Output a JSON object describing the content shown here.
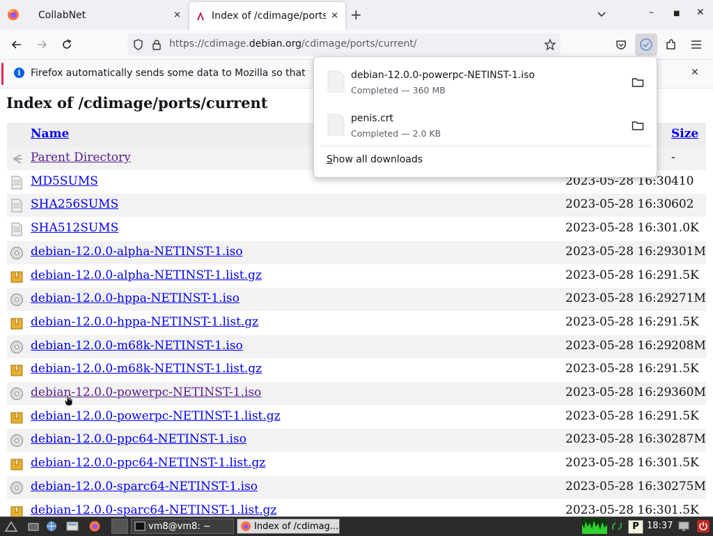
{
  "browser": {
    "tabs": [
      {
        "label": "CollabNet"
      },
      {
        "label": "Index of /cdimage/ports/current/"
      }
    ],
    "url": {
      "prefix": "https://cdimage.",
      "domain": "debian.org",
      "path": "/cdimage/ports/current/"
    },
    "notification": "Firefox automatically sends some data to Mozilla so that we can improve your experience."
  },
  "downloads": {
    "items": [
      {
        "name": "debian-12.0.0-powerpc-NETINST-1.iso",
        "status": "Completed — 360 MB"
      },
      {
        "name": "penis.crt",
        "status": "Completed — 2.0 KB"
      }
    ],
    "show_all_accel": "S",
    "show_all_rest": "how all downloads"
  },
  "page": {
    "heading": "Index of /cdimage/ports/current",
    "columns": {
      "name": "Name",
      "size": "Size"
    },
    "rows": [
      {
        "name": "Parent Directory",
        "date": "",
        "size": "-",
        "icon": "parent-dir-icon",
        "visited": true
      },
      {
        "name": "MD5SUMS",
        "date": "2023-05-28 16:30",
        "size": "410",
        "icon": "text-file-icon",
        "visited": false
      },
      {
        "name": "SHA256SUMS",
        "date": "2023-05-28 16:30",
        "size": "602",
        "icon": "text-file-icon",
        "visited": false
      },
      {
        "name": "SHA512SUMS",
        "date": "2023-05-28 16:30",
        "size": "1.0K",
        "icon": "text-file-icon",
        "visited": false
      },
      {
        "name": "debian-12.0.0-alpha-NETINST-1.iso",
        "date": "2023-05-28 16:29",
        "size": "301M",
        "icon": "disc-icon",
        "visited": false
      },
      {
        "name": "debian-12.0.0-alpha-NETINST-1.list.gz",
        "date": "2023-05-28 16:29",
        "size": "1.5K",
        "icon": "archive-icon",
        "visited": false
      },
      {
        "name": "debian-12.0.0-hppa-NETINST-1.iso",
        "date": "2023-05-28 16:29",
        "size": "271M",
        "icon": "disc-icon",
        "visited": false
      },
      {
        "name": "debian-12.0.0-hppa-NETINST-1.list.gz",
        "date": "2023-05-28 16:29",
        "size": "1.5K",
        "icon": "archive-icon",
        "visited": false
      },
      {
        "name": "debian-12.0.0-m68k-NETINST-1.iso",
        "date": "2023-05-28 16:29",
        "size": "208M",
        "icon": "disc-icon",
        "visited": false
      },
      {
        "name": "debian-12.0.0-m68k-NETINST-1.list.gz",
        "date": "2023-05-28 16:29",
        "size": "1.5K",
        "icon": "archive-icon",
        "visited": false
      },
      {
        "name": "debian-12.0.0-powerpc-NETINST-1.iso",
        "date": "2023-05-28 16:29",
        "size": "360M",
        "icon": "disc-icon",
        "visited": true
      },
      {
        "name": "debian-12.0.0-powerpc-NETINST-1.list.gz",
        "date": "2023-05-28 16:29",
        "size": "1.5K",
        "icon": "archive-icon",
        "visited": false
      },
      {
        "name": "debian-12.0.0-ppc64-NETINST-1.iso",
        "date": "2023-05-28 16:30",
        "size": "287M",
        "icon": "disc-icon",
        "visited": false
      },
      {
        "name": "debian-12.0.0-ppc64-NETINST-1.list.gz",
        "date": "2023-05-28 16:30",
        "size": "1.5K",
        "icon": "archive-icon",
        "visited": false
      },
      {
        "name": "debian-12.0.0-sparc64-NETINST-1.iso",
        "date": "2023-05-28 16:30",
        "size": "275M",
        "icon": "disc-icon",
        "visited": false
      },
      {
        "name": "debian-12.0.0-sparc64-NETINST-1.list.gz",
        "date": "2023-05-28 16:30",
        "size": "1.5K",
        "icon": "archive-icon",
        "visited": false
      }
    ]
  },
  "taskbar": {
    "windows": [
      {
        "label": "vm8@vm8: ~"
      },
      {
        "label": "Index of /cdimag..."
      }
    ],
    "clock": "18:37"
  }
}
